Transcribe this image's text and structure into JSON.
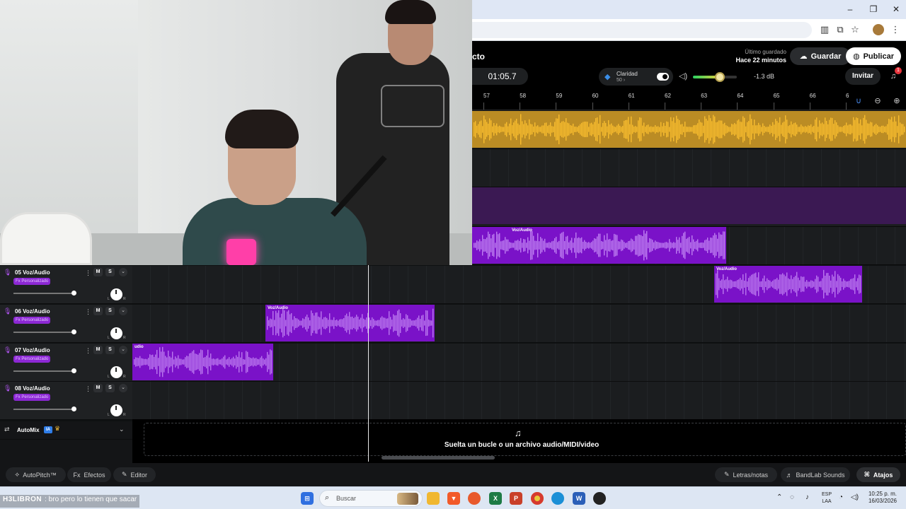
{
  "browser": {
    "window_controls": [
      "minimize",
      "maximize",
      "close"
    ],
    "address_icons": [
      "tab-search-icon",
      "cast-icon",
      "star-icon",
      "avatar",
      "kebab-menu-icon"
    ]
  },
  "header": {
    "project_title_fragment": "cto",
    "last_saved_label": "Último guardado",
    "last_saved_time": "Hace 22 minutos",
    "save_label": "Guardar",
    "publish_label": "Publicar",
    "timecode": "01:05.7",
    "claridad_label": "Claridad",
    "claridad_value": "50 ›",
    "claridad_enabled": true,
    "volume_db": "-1.3 dB",
    "volume_level": 0.62,
    "invite_label": "Invitar",
    "notifications_count": "1"
  },
  "ruler": {
    "bars": [
      "57",
      "58",
      "59",
      "60",
      "61",
      "62",
      "63",
      "64",
      "65",
      "66",
      "6"
    ]
  },
  "upper_clips": {
    "clip_label": "Voz/Audio"
  },
  "tracks": [
    {
      "number": "05",
      "name": "Voz/Audio",
      "fx": "Fx Personalizado",
      "mute": "M",
      "solo": "S",
      "clip_label": "Voz/Audio"
    },
    {
      "number": "06",
      "name": "Voz/Audio",
      "fx": "Fx Personalizado",
      "mute": "M",
      "solo": "S",
      "clip_label": "Voz/Audio"
    },
    {
      "number": "07",
      "name": "Voz/Audio",
      "fx": "Fx Personalizado",
      "mute": "M",
      "solo": "S",
      "clip_label": "udio"
    },
    {
      "number": "08",
      "name": "Voz/Audio",
      "fx": "Fx Personalizado",
      "mute": "M",
      "solo": "S",
      "clip_label": ""
    }
  ],
  "pan": {
    "left": "L",
    "right": "R"
  },
  "automix": {
    "label": "AutoMix",
    "badge": "IA"
  },
  "dropzone": {
    "text": "Suelta un bucle o un archivo audio/MIDI/video"
  },
  "bottom_bar": {
    "autopitch": "AutoPitch™",
    "effects": "Efectos",
    "effects_prefix": "Fx",
    "editor": "Editor",
    "lyrics": "Letras/notas",
    "sounds": "BandLab Sounds",
    "shortcuts": "Atajos"
  },
  "taskbar": {
    "search_placeholder": "Buscar",
    "language_line1": "ESP",
    "language_line2": "LAA",
    "time": "10:25 p. m.",
    "date": "16/03/2026"
  },
  "chat": {
    "user": "H3LIBRON",
    "message": ": bro pero lo tienen que sacar"
  },
  "colors": {
    "accent_purple": "#7a12c8",
    "gold_track": "#f7b52b",
    "background": "#0f1112"
  }
}
